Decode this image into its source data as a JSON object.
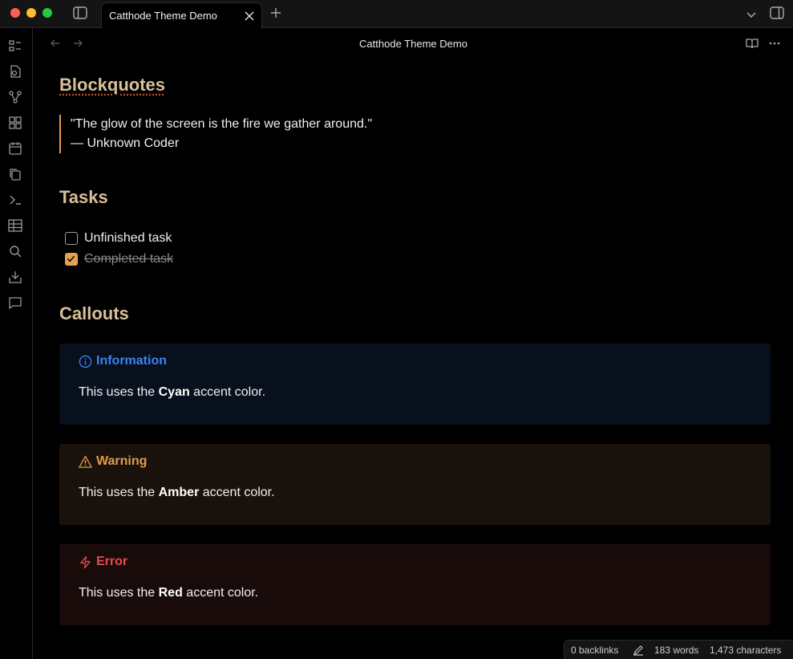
{
  "tab": {
    "title": "Catthode Theme Demo"
  },
  "view": {
    "title": "Catthode Theme Demo"
  },
  "sections": {
    "blockquotes": {
      "heading": "Blockquotes",
      "quote_line1": "\"The glow of the screen is the fire we gather around.\"",
      "quote_line2": "— Unknown Coder"
    },
    "tasks": {
      "heading": "Tasks",
      "items": [
        {
          "label": "Unfinished task",
          "checked": false
        },
        {
          "label": "Completed task",
          "checked": true
        }
      ]
    },
    "callouts": {
      "heading": "Callouts",
      "items": [
        {
          "title": "Information",
          "body_prefix": "This uses the ",
          "body_bold": "Cyan",
          "body_suffix": " accent color.",
          "icon": "info-icon",
          "color": "#3b82f6"
        },
        {
          "title": "Warning",
          "body_prefix": "This uses the ",
          "body_bold": "Amber",
          "body_suffix": " accent color.",
          "icon": "warning-icon",
          "color": "#e39a4a"
        },
        {
          "title": "Error",
          "body_prefix": "This uses the ",
          "body_bold": "Red",
          "body_suffix": " accent color.",
          "icon": "lightning-icon",
          "color": "#e24c4c"
        }
      ]
    }
  },
  "status": {
    "backlinks": "0 backlinks",
    "words": "183 words",
    "characters": "1,473 characters"
  },
  "colors": {
    "heading": "#d9bf9a",
    "accent_amber": "#e8a04e",
    "background": "#000000"
  }
}
